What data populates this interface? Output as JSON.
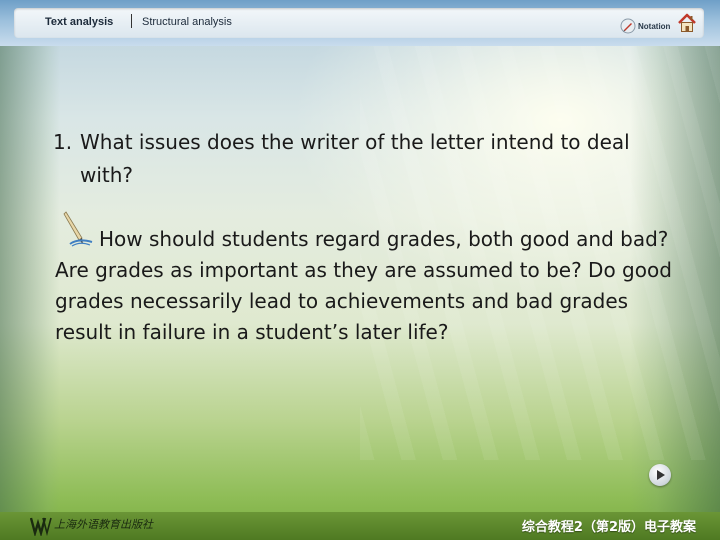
{
  "header": {
    "tabs": [
      {
        "label": "Text analysis"
      },
      {
        "label": "Structural analysis"
      }
    ],
    "notation_label": "Notation",
    "icons": [
      "pencil-icon",
      "home-icon"
    ]
  },
  "content": {
    "question_number": "1.",
    "question_line1": "What issues does the writer of the letter intend to deal",
    "question_line2": "with?",
    "answer": "How should students regard grades, both good and bad? Are grades as important as they are assumed to be? Do good grades necessarily lead to achievements and bad grades result in failure in a student’s later life?",
    "answer_icon": "pen-icon"
  },
  "navigation": {
    "next_icon": "play-icon"
  },
  "footer": {
    "publisher": "上海外语教育出版社",
    "course_title": "综合教程2（第2版）电子教案"
  },
  "colors": {
    "top_bar": "#6f9fc7",
    "bottom_bar": "#5a862a",
    "text": "#1a1a1a"
  }
}
